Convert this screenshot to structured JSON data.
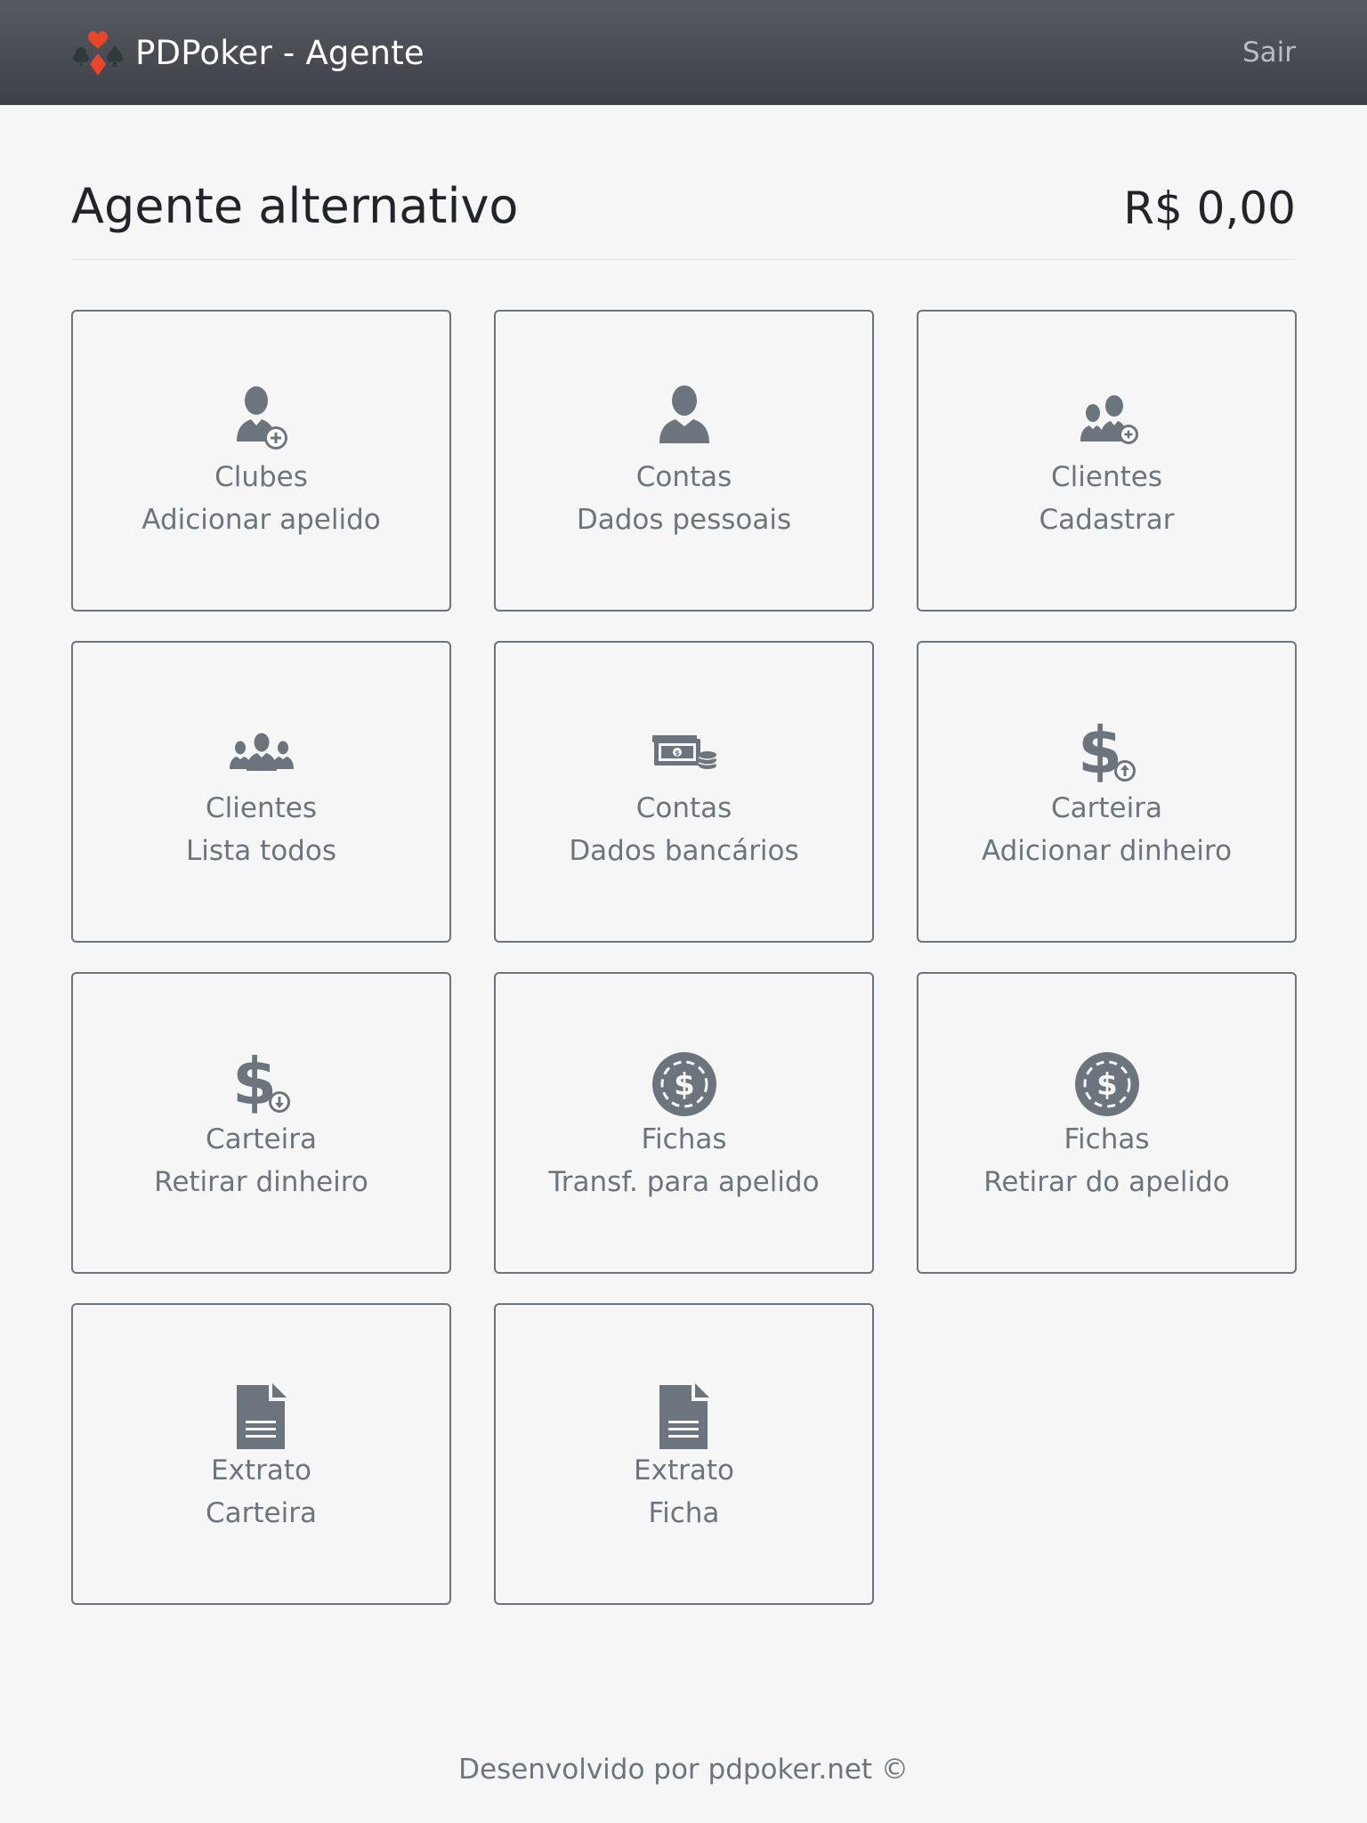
{
  "nav": {
    "brand": "PDPoker - Agente",
    "logout": "Sair"
  },
  "header": {
    "title": "Agente alternativo",
    "balance": "R$ 0,00"
  },
  "cards": [
    {
      "icon": "user-plus-icon",
      "line1": "Clubes",
      "line2": "Adicionar apelido"
    },
    {
      "icon": "user-icon",
      "line1": "Contas",
      "line2": "Dados pessoais"
    },
    {
      "icon": "users-plus-icon",
      "line1": "Clientes",
      "line2": "Cadastrar"
    },
    {
      "icon": "users-group-icon",
      "line1": "Clientes",
      "line2": "Lista todos"
    },
    {
      "icon": "money-coins-icon",
      "line1": "Contas",
      "line2": "Dados bancários"
    },
    {
      "icon": "dollar-up-icon",
      "line1": "Carteira",
      "line2": "Adicionar dinheiro"
    },
    {
      "icon": "dollar-down-icon",
      "line1": "Carteira",
      "line2": "Retirar dinheiro"
    },
    {
      "icon": "poker-chip-icon",
      "line1": "Fichas",
      "line2": "Transf. para apelido"
    },
    {
      "icon": "poker-chip-icon",
      "line1": "Fichas",
      "line2": "Retirar do apelido"
    },
    {
      "icon": "document-icon",
      "line1": "Extrato",
      "line2": "Carteira"
    },
    {
      "icon": "document-icon",
      "line1": "Extrato",
      "line2": "Ficha"
    }
  ],
  "footer": "Desenvolvido por pdpoker.net ©",
  "colors": {
    "navbar": "#4a4e54",
    "icon": "#6c757d",
    "logo_red": "#e8452c",
    "logo_dark": "#2f3a3a"
  }
}
